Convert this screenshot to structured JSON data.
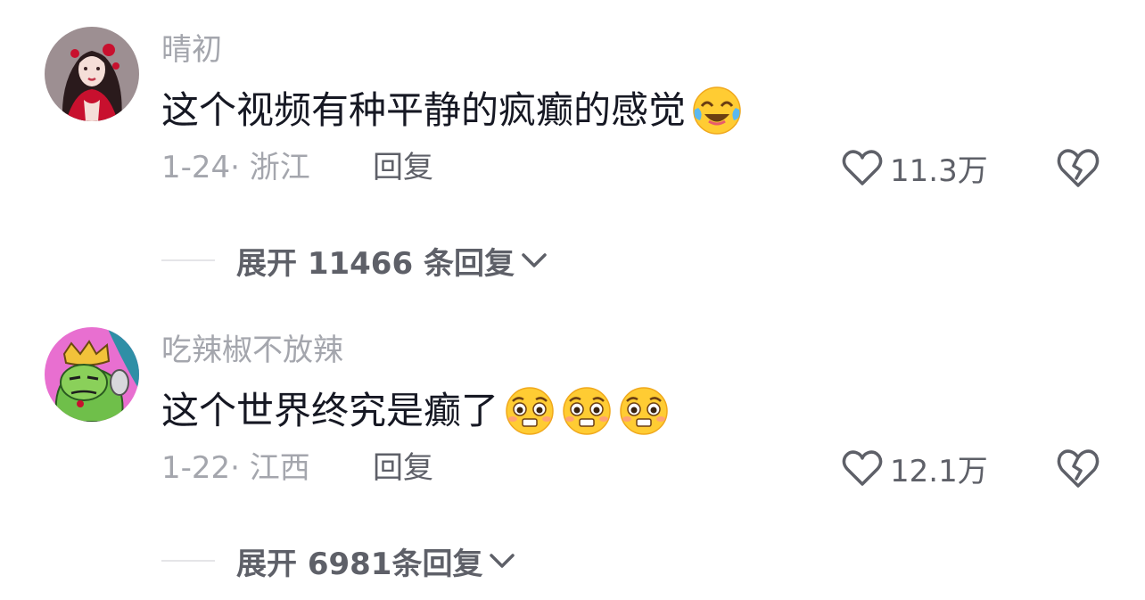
{
  "comments": [
    {
      "username": "晴初",
      "text": "这个视频有种平静的疯癫的感觉",
      "emojis": [
        "tears-of-joy-emoji"
      ],
      "date_location": "1-24· 浙江",
      "reply_label": "回复",
      "likes": "11.3万",
      "expand_label": "展开 11466 条回复"
    },
    {
      "username": "吃辣椒不放辣",
      "text": "这个世界终究是癫了",
      "emojis": [
        "pleading-emoji",
        "pleading-emoji",
        "pleading-emoji"
      ],
      "date_location": "1-22· 江西",
      "reply_label": "回复",
      "likes": "12.1万",
      "expand_label": "展开 6981条回复"
    }
  ],
  "icons": {
    "like": "heart-outline-icon",
    "dislike": "broken-heart-icon",
    "expand": "chevron-down-icon"
  },
  "colors": {
    "primary_text": "#161823",
    "secondary_text": "#a4a6ad",
    "action_text": "#5e6068"
  }
}
